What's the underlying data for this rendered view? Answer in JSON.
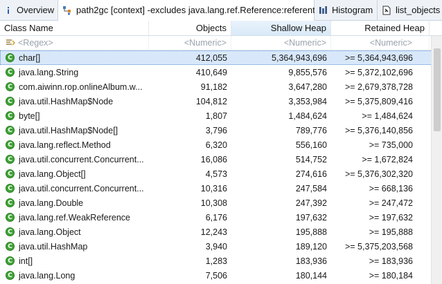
{
  "tabs": [
    {
      "label": "Overview",
      "icon": "info-icon"
    },
    {
      "label": "path2gc [context] -excludes java.lang.ref.Reference:referent",
      "icon": "path-tree-icon"
    },
    {
      "label": "Histogram",
      "icon": "histogram-icon"
    },
    {
      "label": "list_objects",
      "icon": "list-objects-icon"
    }
  ],
  "table": {
    "columns": [
      "Class Name",
      "Objects",
      "Shallow Heap",
      "Retained Heap"
    ],
    "filters": [
      "<Regex>",
      "<Numeric>",
      "<Numeric>",
      "<Numeric>"
    ],
    "rows": [
      {
        "name": "char[]",
        "objects": "412,055",
        "shallow": "5,364,943,696",
        "retained": ">= 5,364,943,696"
      },
      {
        "name": "java.lang.String",
        "objects": "410,649",
        "shallow": "9,855,576",
        "retained": ">= 5,372,102,696"
      },
      {
        "name": "com.aiwinn.rop.onlineAlbum.w...",
        "objects": "91,182",
        "shallow": "3,647,280",
        "retained": ">= 2,679,378,728"
      },
      {
        "name": "java.util.HashMap$Node",
        "objects": "104,812",
        "shallow": "3,353,984",
        "retained": ">= 5,375,809,416"
      },
      {
        "name": "byte[]",
        "objects": "1,807",
        "shallow": "1,484,624",
        "retained": ">= 1,484,624"
      },
      {
        "name": "java.util.HashMap$Node[]",
        "objects": "3,796",
        "shallow": "789,776",
        "retained": ">= 5,376,140,856"
      },
      {
        "name": "java.lang.reflect.Method",
        "objects": "6,320",
        "shallow": "556,160",
        "retained": ">= 735,000"
      },
      {
        "name": "java.util.concurrent.Concurrent...",
        "objects": "16,086",
        "shallow": "514,752",
        "retained": ">= 1,672,824"
      },
      {
        "name": "java.lang.Object[]",
        "objects": "4,573",
        "shallow": "274,616",
        "retained": ">= 5,376,302,320"
      },
      {
        "name": "java.util.concurrent.Concurrent...",
        "objects": "10,316",
        "shallow": "247,584",
        "retained": ">= 668,136"
      },
      {
        "name": "java.lang.Double",
        "objects": "10,308",
        "shallow": "247,392",
        "retained": ">= 247,472"
      },
      {
        "name": "java.lang.ref.WeakReference",
        "objects": "6,176",
        "shallow": "197,632",
        "retained": ">= 197,632"
      },
      {
        "name": "java.lang.Object",
        "objects": "12,243",
        "shallow": "195,888",
        "retained": ">= 195,888"
      },
      {
        "name": "java.util.HashMap",
        "objects": "3,940",
        "shallow": "189,120",
        "retained": ">= 5,375,203,568"
      },
      {
        "name": "int[]",
        "objects": "1,283",
        "shallow": "183,936",
        "retained": ">= 183,936"
      },
      {
        "name": "java.lang.Long",
        "objects": "7,506",
        "shallow": "180,144",
        "retained": ">= 180,184"
      }
    ]
  }
}
